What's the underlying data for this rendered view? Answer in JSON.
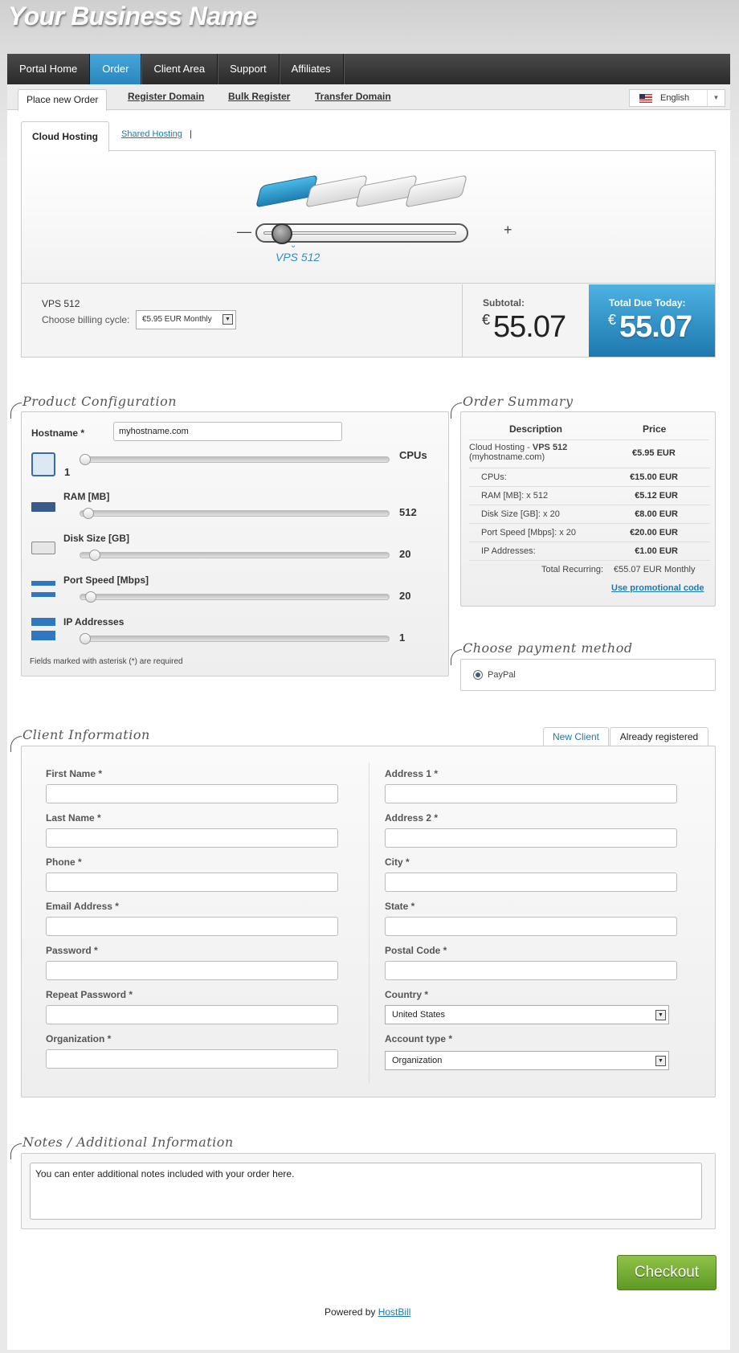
{
  "brand": "Your Business Name",
  "nav": [
    "Portal Home",
    "Order",
    "Client Area",
    "Support",
    "Affiliates"
  ],
  "subtabs": [
    "Place new Order",
    "Register Domain",
    "Bulk Register",
    "Transfer Domain"
  ],
  "language": "English",
  "hosting_tabs": {
    "active": "Cloud Hosting",
    "other": "Shared Hosting",
    "separator": "|"
  },
  "product": {
    "slider_caption": "VPS 512",
    "name": "VPS 512",
    "cycle_label": "Choose billing cycle:",
    "cycle_value": "€5.95 EUR Monthly",
    "subtotal_label": "Subtotal:",
    "subtotal_currency": "€",
    "subtotal_value": "55.07",
    "total_label": "Total Due Today:",
    "total_currency": "€",
    "total_value": "55.07"
  },
  "config": {
    "title": "Product Configuration",
    "hostname_label": "Hostname *",
    "hostname_value": "myhostname.com",
    "cpu_unit": "CPUs",
    "cpu_value": "1",
    "ram_label": "RAM [MB]",
    "ram_value": "512",
    "disk_label": "Disk Size [GB]",
    "disk_value": "20",
    "port_label": "Port Speed [Mbps]",
    "port_value": "20",
    "ip_label": "IP Addresses",
    "ip_value": "1",
    "required_note": "Fields marked with asterisk (*) are required"
  },
  "summary": {
    "title": "Order Summary",
    "col_description": "Description",
    "col_price": "Price",
    "main_item_prefix": "Cloud Hosting - ",
    "main_item_bold": "VPS 512",
    "main_item_host": "(myhostname.com)",
    "main_item_price": "€5.95 EUR",
    "rows": [
      {
        "d": "CPUs:",
        "p": "€15.00 EUR"
      },
      {
        "d": "RAM [MB]: x 512",
        "p": "€5.12 EUR"
      },
      {
        "d": "Disk Size [GB]: x 20",
        "p": "€8.00 EUR"
      },
      {
        "d": "Port Speed [Mbps]: x 20",
        "p": "€20.00 EUR"
      },
      {
        "d": "IP Addresses:",
        "p": "€1.00 EUR"
      }
    ],
    "recurring_label": "Total Recurring:",
    "recurring_value": "€55.07 EUR Monthly",
    "promo": "Use promotional code"
  },
  "payment": {
    "title": "Choose payment method",
    "option": "PayPal"
  },
  "client": {
    "title": "Client Information",
    "tab_new": "New Client",
    "tab_registered": "Already registered",
    "left_fields": [
      "First Name *",
      "Last Name *",
      "Phone *",
      "Email Address *",
      "Password *",
      "Repeat Password *",
      "Organization *"
    ],
    "right_fields": [
      "Address 1 *",
      "Address 2 *",
      "City *",
      "State *",
      "Postal Code *"
    ],
    "country_label": "Country *",
    "country_value": "United States",
    "account_label": "Account type *",
    "account_value": "Organization"
  },
  "notes": {
    "title": "Notes / Additional Information",
    "placeholder": "You can enter additional notes included with your order here."
  },
  "checkout": "Checkout",
  "footer": {
    "prefix": "Powered by ",
    "link": "HostBill"
  },
  "colors": {
    "accent": "#2a8ec9",
    "checkout": "#76ad35",
    "nav_dark": "#333333"
  }
}
